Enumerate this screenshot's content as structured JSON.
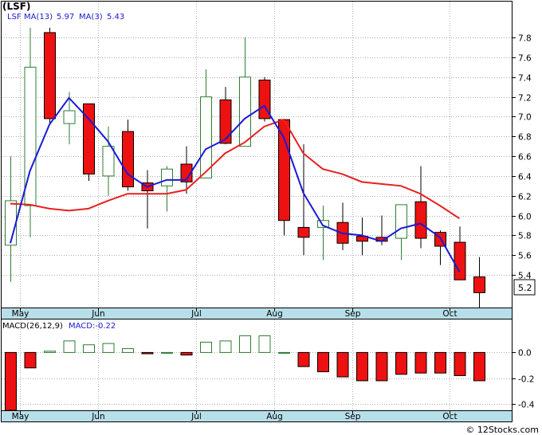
{
  "header": {
    "ticker": "(LSF)",
    "legend_symbol": "LSF",
    "ma1_label": "MA(13)",
    "ma1_value": "5.97",
    "ma2_label": "MA(3)",
    "ma2_value": "5.43",
    "macd_label": "MACD(26,12,9)",
    "macd_value_label": "MACD:-0.22",
    "watermark": "© 12Stocks.com",
    "last_price_tag": "5.2"
  },
  "colors": {
    "up_candle_stroke": "#2e7d32",
    "down_candle_fill": "#ee1111",
    "ma13": "#e82020",
    "ma3": "#1a1ad6",
    "axis_band": "#b7dfe9",
    "grid": "#b0b0b0",
    "frame": "#000000"
  },
  "chart_data": [
    {
      "type": "candlestick",
      "name": "price",
      "y_axis_ticks": [
        5.4,
        5.6,
        5.8,
        6.0,
        6.2,
        6.4,
        6.6,
        6.8,
        7.0,
        7.2,
        7.4,
        7.6,
        7.8
      ],
      "y_tick_labels": [
        "5.4",
        "5.6",
        "5.8",
        "6.0",
        "6.2",
        "6.4",
        "6.6",
        "6.8",
        "7.0",
        "7.2",
        "7.4",
        "7.6",
        "7.8"
      ],
      "ylim": [
        5.07,
        7.97
      ],
      "x_month_labels": [
        {
          "label": "May",
          "after_bar": 1
        },
        {
          "label": "Jun",
          "after_bar": 5
        },
        {
          "label": "Jul",
          "after_bar": 10
        },
        {
          "label": "Aug",
          "after_bar": 14
        },
        {
          "label": "Sep",
          "after_bar": 18
        },
        {
          "label": "Oct",
          "after_bar": 23
        }
      ],
      "candles": [
        {
          "o": 5.7,
          "h": 6.6,
          "l": 5.33,
          "c": 6.15
        },
        {
          "o": 6.1,
          "h": 7.9,
          "l": 5.78,
          "c": 7.5
        },
        {
          "o": 7.85,
          "h": 7.9,
          "l": 6.93,
          "c": 6.98
        },
        {
          "o": 6.93,
          "h": 7.25,
          "l": 6.72,
          "c": 7.06
        },
        {
          "o": 7.13,
          "h": 7.13,
          "l": 6.35,
          "c": 6.42
        },
        {
          "o": 6.4,
          "h": 6.9,
          "l": 6.2,
          "c": 6.7
        },
        {
          "o": 6.85,
          "h": 6.97,
          "l": 6.25,
          "c": 6.29
        },
        {
          "o": 6.33,
          "h": 6.46,
          "l": 5.87,
          "c": 6.25
        },
        {
          "o": 6.3,
          "h": 6.5,
          "l": 6.04,
          "c": 6.47
        },
        {
          "o": 6.52,
          "h": 6.7,
          "l": 6.22,
          "c": 6.34
        },
        {
          "o": 6.38,
          "h": 7.48,
          "l": 6.38,
          "c": 7.2
        },
        {
          "o": 7.17,
          "h": 7.3,
          "l": 6.72,
          "c": 6.73
        },
        {
          "o": 6.7,
          "h": 7.8,
          "l": 6.7,
          "c": 7.4
        },
        {
          "o": 7.37,
          "h": 7.4,
          "l": 6.95,
          "c": 6.98
        },
        {
          "o": 6.97,
          "h": 6.97,
          "l": 5.8,
          "c": 5.95
        },
        {
          "o": 5.88,
          "h": 6.72,
          "l": 5.6,
          "c": 5.78
        },
        {
          "o": 5.88,
          "h": 6.1,
          "l": 5.55,
          "c": 5.95
        },
        {
          "o": 5.93,
          "h": 6.13,
          "l": 5.65,
          "c": 5.72
        },
        {
          "o": 5.79,
          "h": 5.98,
          "l": 5.6,
          "c": 5.74
        },
        {
          "o": 5.78,
          "h": 6.0,
          "l": 5.7,
          "c": 5.74
        },
        {
          "o": 5.77,
          "h": 6.1,
          "l": 5.55,
          "c": 6.11
        },
        {
          "o": 6.14,
          "h": 6.5,
          "l": 5.67,
          "c": 5.77
        },
        {
          "o": 5.83,
          "h": 5.85,
          "l": 5.5,
          "c": 5.69
        },
        {
          "o": 5.73,
          "h": 5.89,
          "l": 5.35,
          "c": 5.35
        },
        {
          "o": 5.38,
          "h": 5.58,
          "l": 5.07,
          "c": 5.22
        }
      ],
      "ma13": [
        6.12,
        6.11,
        6.07,
        6.05,
        6.07,
        6.15,
        6.22,
        6.22,
        6.22,
        6.26,
        6.44,
        6.63,
        6.74,
        6.9,
        6.97,
        6.63,
        6.47,
        6.42,
        6.34,
        6.32,
        6.3,
        6.22,
        6.1,
        5.97
      ],
      "ma3": [
        5.72,
        6.45,
        6.92,
        7.19,
        6.98,
        6.75,
        6.42,
        6.29,
        6.36,
        6.36,
        6.67,
        6.77,
        6.98,
        7.11,
        6.79,
        6.23,
        5.9,
        5.82,
        5.8,
        5.74,
        5.87,
        5.92,
        5.78,
        5.43
      ]
    },
    {
      "type": "bar",
      "name": "macd",
      "y_axis_ticks": [
        -0.4,
        -0.2,
        0.0
      ],
      "y_tick_labels": [
        "-0.4",
        "-0.2",
        "0.0"
      ],
      "ylim": [
        -0.45,
        0.17
      ],
      "values": [
        -0.45,
        -0.12,
        0.01,
        0.09,
        0.06,
        0.07,
        0.03,
        -0.01,
        0.0,
        -0.02,
        0.08,
        0.09,
        0.13,
        0.13,
        0.0,
        -0.11,
        -0.15,
        -0.19,
        -0.22,
        -0.22,
        -0.17,
        -0.16,
        -0.16,
        -0.18,
        -0.22
      ]
    }
  ]
}
